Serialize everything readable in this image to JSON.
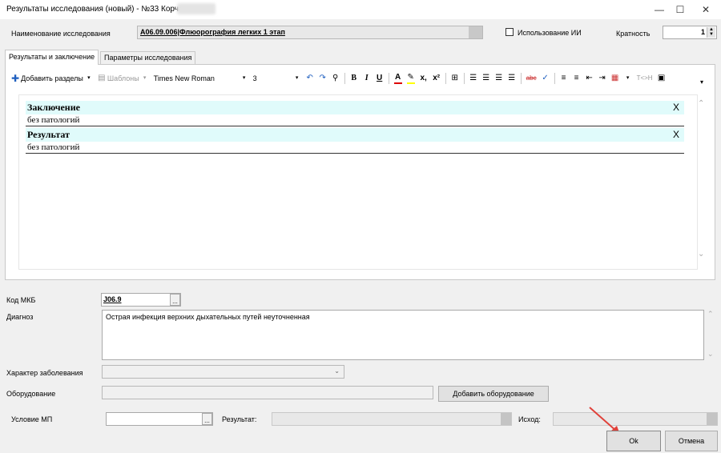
{
  "window": {
    "title": "Результаты исследования (новый) - №33 Корчагин",
    "minimize": "—",
    "maximize": "☐",
    "close": "✕"
  },
  "header": {
    "study_label": "Наименование исследования",
    "study_value": "A06.09.006|Флюорография легких 1 этап",
    "ai_label": "Использование ИИ",
    "multiplicity_label": "Кратность",
    "multiplicity_value": "1"
  },
  "tabs": [
    {
      "label": "Результаты и заключение"
    },
    {
      "label": "Параметры исследования"
    }
  ],
  "toolbar": {
    "add_sections": "Добавить разделы",
    "templates": "Шаблоны",
    "font_family": "Times New Roman",
    "font_size": "3",
    "bold": "B",
    "italic": "I",
    "underline": "U",
    "subscript": "x,",
    "superscript": "x²",
    "tag_label": "T<>H"
  },
  "editor": {
    "sections": [
      {
        "title": "Заключение",
        "text": "без патологий",
        "remove": "X"
      },
      {
        "title": "Результат",
        "text": "без патологий",
        "remove": "X"
      }
    ]
  },
  "form": {
    "mkb_label": "Код МКБ",
    "mkb_value": "J06.9",
    "diagnosis_label": "Диагноз",
    "diagnosis_value": "Острая инфекция верхних дыхательных путей неуточненная",
    "character_label": "Характер заболевания",
    "equipment_label": "Оборудование",
    "add_equipment": "Добавить оборудование",
    "condition_label": "Условие МП",
    "result_label": "Результат:",
    "outcome_label": "Исход:",
    "ellipsis": "..."
  },
  "buttons": {
    "ok": "Ok",
    "cancel": "Отмена"
  },
  "colors": {
    "section_bg": "#e0fbfb",
    "arrow": "#e0413a",
    "add_icon": "#1f5fbf"
  }
}
